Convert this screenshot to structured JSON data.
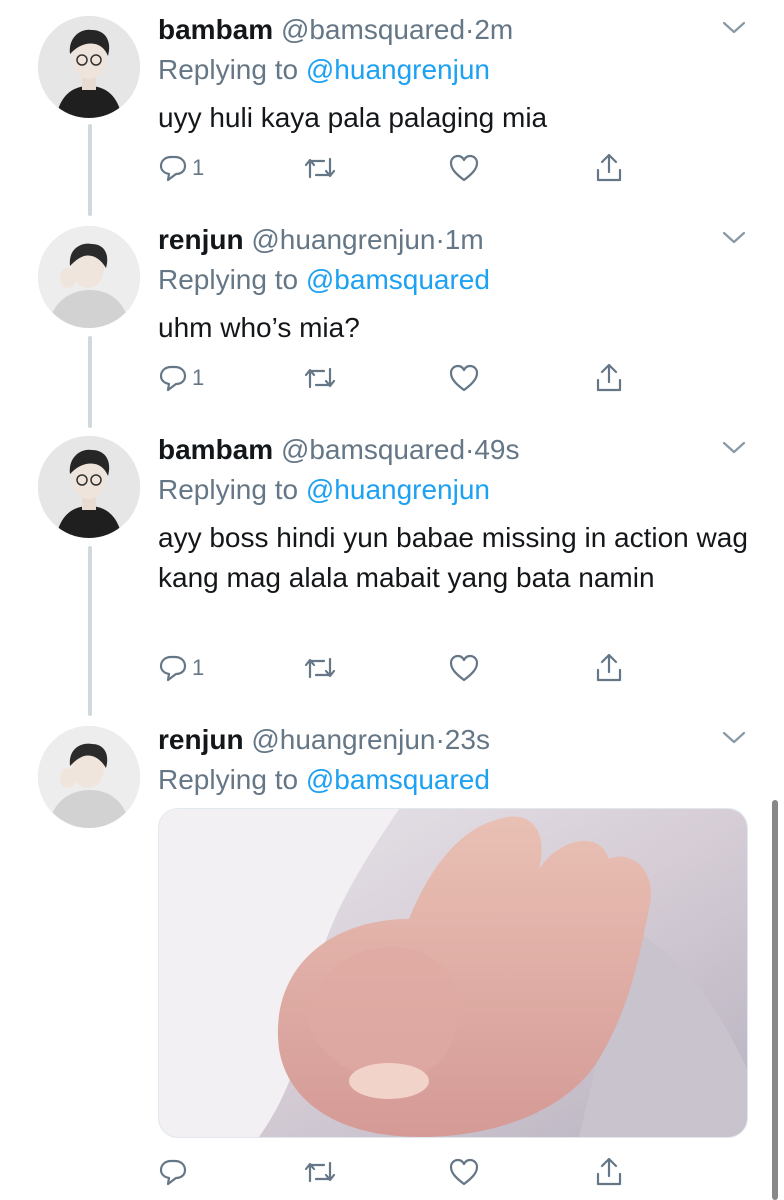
{
  "tweets": [
    {
      "name": "bambam",
      "handle": "@bamsquared",
      "separator": "·",
      "time": "2m",
      "replying_label": "Replying to",
      "replying_to": "@huangrenjun",
      "text": "uyy huli kaya pala palaging mia",
      "reply_count": "1",
      "avatar_icon": "avatar-bambam"
    },
    {
      "name": "renjun",
      "handle": "@huangrenjun",
      "separator": "·",
      "time": "1m",
      "replying_label": "Replying to",
      "replying_to": "@bamsquared",
      "text": "uhm who’s mia?",
      "reply_count": "1",
      "avatar_icon": "avatar-renjun"
    },
    {
      "name": "bambam",
      "handle": "@bamsquared",
      "separator": "·",
      "time": "49s",
      "replying_label": "Replying to",
      "replying_to": "@huangrenjun",
      "text": "ayy boss hindi yun babae missing in action wag kang mag alala mabait yang bata namin",
      "reply_count": "1",
      "avatar_icon": "avatar-bambam"
    },
    {
      "name": "renjun",
      "handle": "@huangrenjun",
      "separator": "·",
      "time": "23s",
      "replying_label": "Replying to",
      "replying_to": "@bamsquared",
      "text": "",
      "reply_count": "",
      "avatar_icon": "avatar-renjun",
      "media": "photo-baby-hand"
    }
  ],
  "icons": {
    "reply": "reply-icon",
    "retweet": "retweet-icon",
    "like": "heart-icon",
    "share": "share-icon",
    "more": "chevron-down-icon"
  },
  "colors": {
    "link": "#1da1f2",
    "muted": "#657786",
    "text": "#14171a",
    "thread_line": "#cfd9de"
  }
}
